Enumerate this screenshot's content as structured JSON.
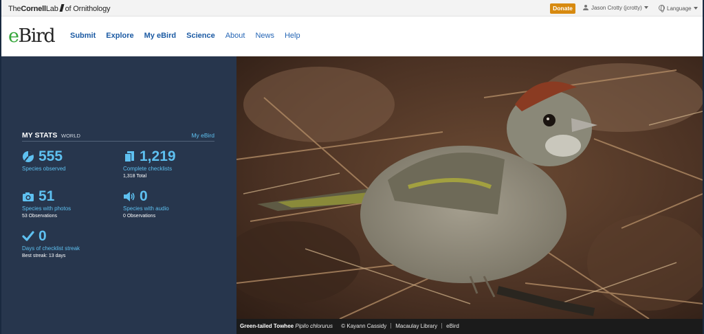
{
  "topbar": {
    "cornell_the": "The",
    "cornell_name": "Cornell",
    "cornell_lab": "Lab",
    "cornell_of": "of Ornithology",
    "donate": "Donate",
    "user": "Jason Crotty (jcrotty)",
    "language": "Language"
  },
  "nav": {
    "logo_e": "e",
    "logo_bird": "Bird",
    "links": [
      "Submit",
      "Explore",
      "My eBird",
      "Science",
      "About",
      "News",
      "Help"
    ]
  },
  "stats": {
    "title": "MY STATS",
    "scope": "WORLD",
    "link": "My eBird",
    "items": [
      {
        "icon": "species-icon",
        "value": "555",
        "label": "Species observed",
        "detail": ""
      },
      {
        "icon": "checklist-icon",
        "value": "1,219",
        "label": "Complete checklists",
        "detail": "1,318 Total"
      },
      {
        "icon": "camera-icon",
        "value": "51",
        "label": "Species with photos",
        "detail": "53 Observations"
      },
      {
        "icon": "speaker-icon",
        "value": "0",
        "label": "Species with audio",
        "detail": "0 Observations"
      },
      {
        "icon": "check-icon",
        "value": "0",
        "label": "Days of checklist streak",
        "detail": "Best streak: 13 days"
      }
    ]
  },
  "photo": {
    "common_name": "Green-tailed Towhee",
    "sci_name": "Pipilo chlorurus",
    "credit": "© Kayann Cassidy",
    "source": "Macaulay Library",
    "brand": "eBird"
  },
  "colors": {
    "accent": "#5ec0f0",
    "panel": "#27364d",
    "donate": "#d78a10",
    "nav_link": "#1b5aa3",
    "logo_green": "#35a63a"
  }
}
